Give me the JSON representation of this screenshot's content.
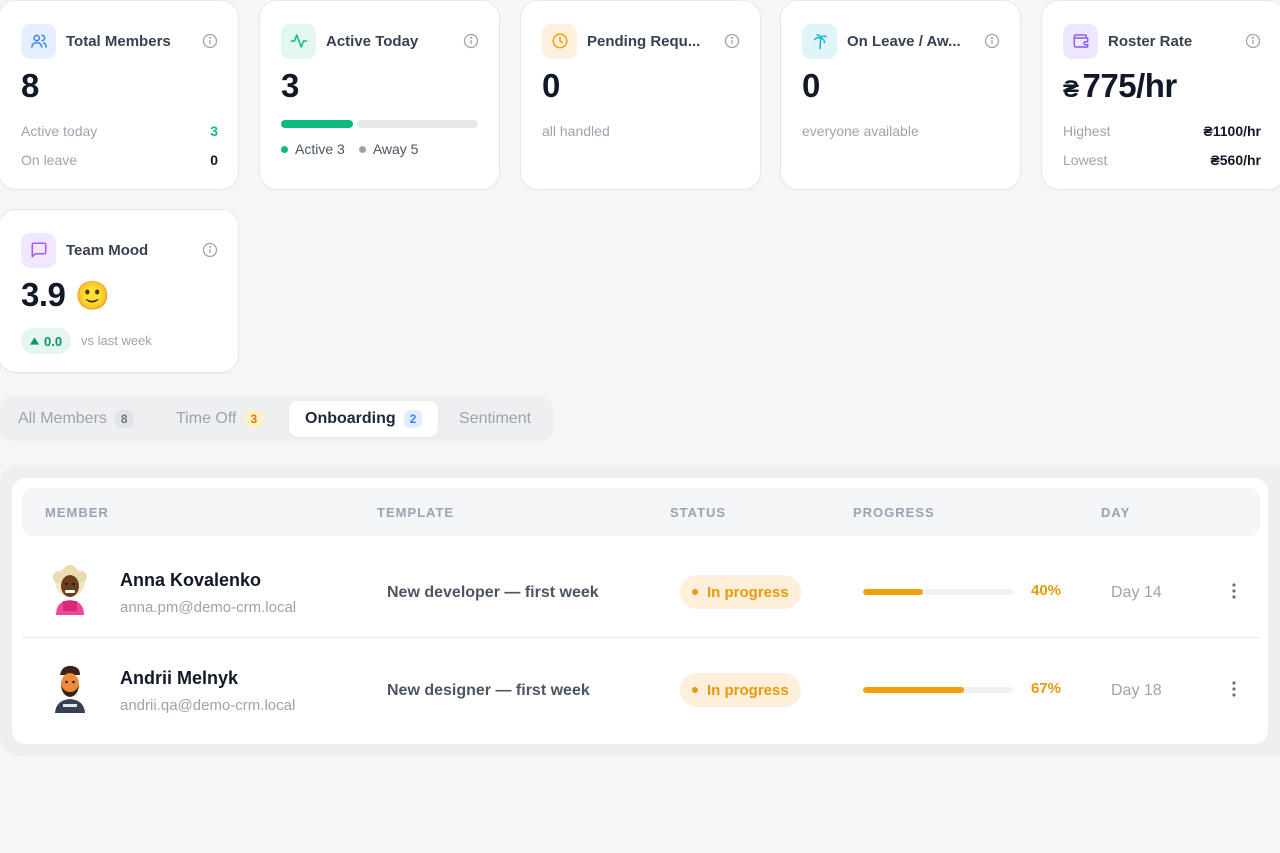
{
  "colors": {
    "accent_green": "#10b981",
    "accent_amber": "#f59e0b",
    "accent_purple": "#8b5cf6",
    "accent_blue": "#3b82f6"
  },
  "cards": {
    "total_members": {
      "icon": "users-icon",
      "title": "Total Members",
      "value": "8",
      "rows": [
        {
          "label": "Active today",
          "value": "3"
        },
        {
          "label": "On leave",
          "value": "0"
        }
      ]
    },
    "active_today": {
      "icon": "activity-icon",
      "title": "Active Today",
      "value": "3",
      "progress_fraction": 0.375,
      "legend_active": "Active 3",
      "legend_away": "Away 5"
    },
    "pending_requests": {
      "icon": "clock-icon",
      "title": "Pending Requ...",
      "value": "0",
      "note": "all handled"
    },
    "on_leave": {
      "icon": "palm-tree-icon",
      "title": "On Leave / Aw...",
      "value": "0",
      "note": "everyone available"
    },
    "roster_rate": {
      "icon": "wallet-icon",
      "title": "Roster Rate",
      "currency": "₴",
      "value": "775/hr",
      "rows": [
        {
          "label": "Highest",
          "value": "₴1100/hr"
        },
        {
          "label": "Lowest",
          "value": "₴560/hr"
        }
      ]
    },
    "team_mood": {
      "icon": "message-square-icon",
      "title": "Team Mood",
      "value": "3.9",
      "emoji": "🙂",
      "delta": "0.0",
      "delta_note": "vs last week"
    }
  },
  "tabs": [
    {
      "label": "All Members",
      "count": "8"
    },
    {
      "label": "Time Off",
      "count": "3"
    },
    {
      "label": "Onboarding",
      "count": "2",
      "active": true
    },
    {
      "label": "Sentiment"
    }
  ],
  "table": {
    "headers": [
      "MEMBER",
      "TEMPLATE",
      "STATUS",
      "PROGRESS",
      "DAY"
    ],
    "rows": [
      {
        "name": "Anna Kovalenko",
        "email": "anna.pm@demo-crm.local",
        "template": "New developer — first week",
        "status": "In progress",
        "progress": 0.4,
        "progress_label": "40%",
        "day": "Day 14"
      },
      {
        "name": "Andrii Melnyk",
        "email": "andrii.qa@demo-crm.local",
        "template": "New designer — first week",
        "status": "In progress",
        "progress": 0.67,
        "progress_label": "67%",
        "day": "Day 18"
      }
    ]
  }
}
